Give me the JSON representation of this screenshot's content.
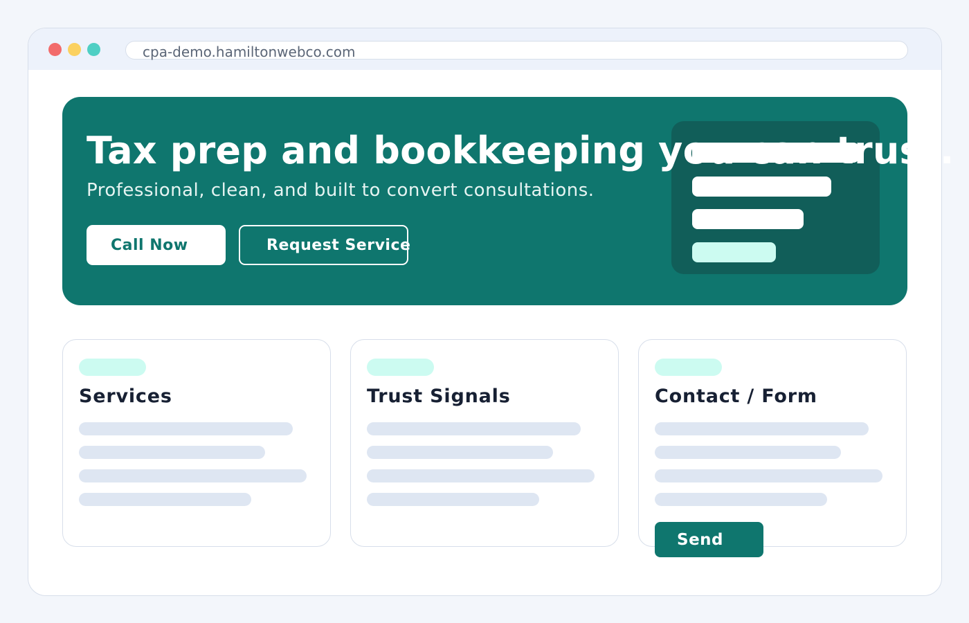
{
  "browser": {
    "url": "cpa-demo.hamiltonwebco.com"
  },
  "hero": {
    "title": "Tax prep and bookkeeping you can trust.",
    "subtitle": "Professional, clean, and built to convert consultations.",
    "primary_button": "Call Now",
    "secondary_button": "Request Service"
  },
  "cards": [
    {
      "title": "Services"
    },
    {
      "title": "Trust Signals"
    },
    {
      "title": "Contact / Form"
    }
  ],
  "form": {
    "send_label": "Send"
  },
  "colors": {
    "brand": "#0f766e",
    "brand_dark": "#115e59",
    "accent_light": "#ccfbf1",
    "skeleton": "#dee6f2"
  }
}
